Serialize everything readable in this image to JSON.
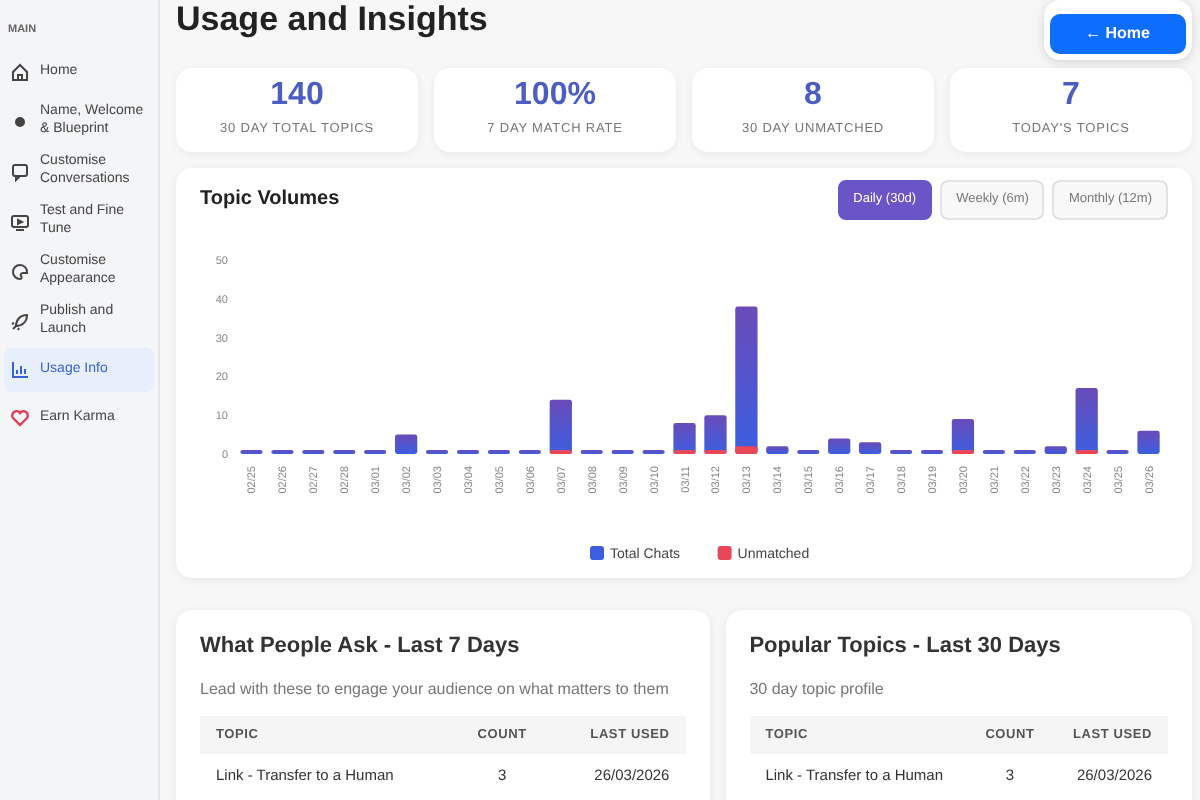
{
  "sidebar": {
    "section": "MAIN",
    "items": [
      {
        "label": "Home",
        "selected": false
      },
      {
        "label": "Name, Welcome & Blueprint",
        "selected": false
      },
      {
        "label": "Customise Conversations",
        "selected": false
      },
      {
        "label": "Test and Fine Tune",
        "selected": false
      },
      {
        "label": "Customise Appearance",
        "selected": false
      },
      {
        "label": "Publish and Launch",
        "selected": false
      },
      {
        "label": "Usage Info",
        "selected": true
      },
      {
        "label": "Earn Karma",
        "selected": false
      }
    ]
  },
  "page": {
    "title": "Usage and Insights",
    "home_button": "← Home"
  },
  "stats": [
    {
      "value": "140",
      "label": "30 DAY TOTAL TOPICS"
    },
    {
      "value": "100%",
      "label": "7 DAY MATCH RATE"
    },
    {
      "value": "8",
      "label": "30 DAY UNMATCHED"
    },
    {
      "value": "7",
      "label": "TODAY'S TOPICS"
    }
  ],
  "topic_volumes": {
    "title": "Topic Volumes",
    "ranges": [
      {
        "label": "Daily (30d)",
        "selected": true
      },
      {
        "label": "Weekly (6m)",
        "selected": false
      },
      {
        "label": "Monthly (12m)",
        "selected": false
      }
    ],
    "chart_data": {
      "type": "bar",
      "stacked": false,
      "legend": "bottom",
      "ylim": [
        0,
        50
      ],
      "yticks": [
        0,
        10,
        20,
        30,
        40,
        50
      ],
      "categories": [
        "02/25",
        "02/26",
        "02/27",
        "02/28",
        "03/01",
        "03/02",
        "03/03",
        "03/04",
        "03/05",
        "03/06",
        "03/07",
        "03/08",
        "03/09",
        "03/10",
        "03/11",
        "03/12",
        "03/13",
        "03/14",
        "03/15",
        "03/16",
        "03/17",
        "03/18",
        "03/19",
        "03/20",
        "03/21",
        "03/22",
        "03/23",
        "03/24",
        "03/25",
        "03/26"
      ],
      "series": [
        {
          "name": "Total Chats",
          "color": "#3b5fe0",
          "values": [
            1,
            1,
            1,
            1,
            1,
            5,
            1,
            1,
            1,
            1,
            14,
            1,
            1,
            1,
            8,
            10,
            38,
            2,
            1,
            4,
            3,
            1,
            1,
            9,
            1,
            1,
            2,
            17,
            1,
            6
          ]
        },
        {
          "name": "Unmatched",
          "color": "#e8475a",
          "values": [
            0,
            0,
            0,
            0,
            0,
            0,
            0,
            0,
            0,
            0,
            1,
            0,
            0,
            0,
            1,
            1,
            2,
            0,
            0,
            0,
            0,
            0,
            0,
            1,
            0,
            0,
            0,
            1,
            0,
            0
          ]
        }
      ]
    }
  },
  "panels": [
    {
      "title": "What People Ask - Last 7 Days",
      "subtitle": "Lead with these to engage your audience on what matters to them",
      "columns": [
        "TOPIC",
        "COUNT",
        "LAST USED"
      ],
      "rows": [
        [
          "Link - Transfer to a Human",
          "3",
          "26/03/2026"
        ]
      ]
    },
    {
      "title": "Popular Topics - Last 30 Days",
      "subtitle": "30 day topic profile",
      "columns": [
        "TOPIC",
        "COUNT",
        "LAST USED"
      ],
      "rows": [
        [
          "Link - Transfer to a Human",
          "3",
          "26/03/2026"
        ]
      ]
    }
  ]
}
